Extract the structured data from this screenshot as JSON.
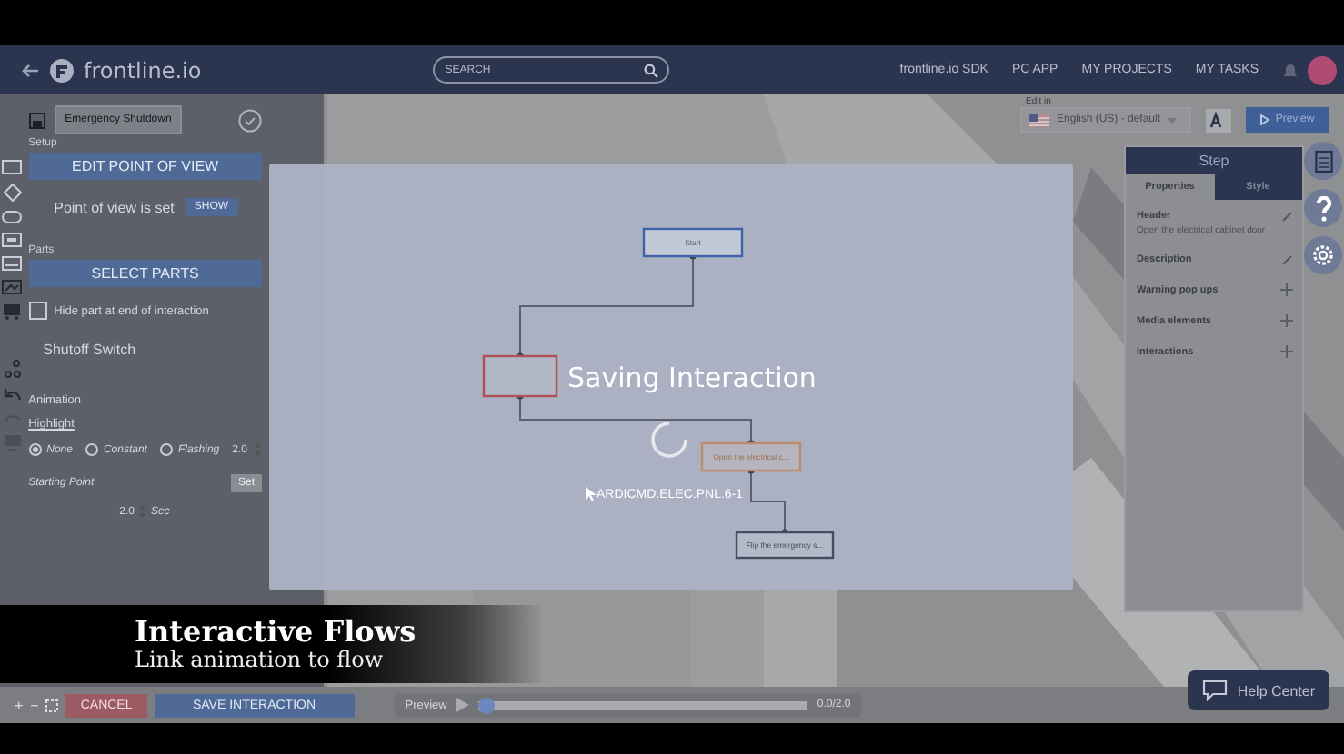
{
  "nav": {
    "logo": "frontline.io",
    "search": {
      "placeholder": "SEARCH"
    },
    "links": [
      "frontline.io SDK",
      "PC APP",
      "MY PROJECTS",
      "MY TASKS"
    ]
  },
  "left_panel": {
    "title": "Emergency Shutdown",
    "ghost_labels": [
      "Setup",
      "Parts"
    ],
    "pov_header": "EDIT POINT OF VIEW",
    "pov_status": "Point of view is set",
    "show_button": "SHOW",
    "parts_header": "SELECT PARTS",
    "hide_part": {
      "label": "Hide part at end of interaction",
      "checked": false
    },
    "part_name": "Shutoff Switch",
    "animation_label": "Animation",
    "highlight_label": "Highlight",
    "highlight_options": [
      {
        "label": "None",
        "selected": true
      },
      {
        "label": "Constant",
        "selected": false
      },
      {
        "label": "Flashing",
        "selected": false
      }
    ],
    "highlight_duration": "2.0",
    "starting_point": "Starting Point",
    "set_button": "Set",
    "start_duration": "2.0",
    "unit": "Sec"
  },
  "editor_toolbar": {
    "edit_in_label": "Edit in",
    "language": "English (US) - default",
    "preview_button": "Preview"
  },
  "step_panel": {
    "title": "Step",
    "tabs": [
      {
        "label": "Properties",
        "selected": true
      },
      {
        "label": "Style",
        "selected": false
      }
    ],
    "fields": [
      {
        "label": "Header",
        "value": "Open the electrical cabinet door",
        "kind": "edit"
      },
      {
        "label": "Description",
        "kind": "edit"
      },
      {
        "label": "Warning pop ups",
        "kind": "add"
      },
      {
        "label": "Media elements",
        "kind": "add"
      },
      {
        "label": "Interactions",
        "kind": "add"
      }
    ]
  },
  "dialog": {
    "message": "Saving Interaction",
    "cursor_label": "ARDICMD.ELEC.PNL.6-1",
    "nodes": [
      {
        "label": "Start",
        "kind": "start"
      },
      {
        "kind": "selected"
      },
      {
        "label": "Open the electrical c...",
        "kind": "pending"
      },
      {
        "label": "Flip the emergency s...",
        "kind": "step"
      }
    ]
  },
  "caption": {
    "title": "Interactive Flows",
    "subtitle": "Link animation to flow"
  },
  "bottom_bar": {
    "cancel_button": "CANCEL",
    "save_button": "SAVE INTERACTION",
    "zoom_in": "+",
    "zoom_out": "−",
    "timeline": {
      "label": "Preview",
      "level": 0.0,
      "reading": "0.0/2.0"
    }
  },
  "help_button": "Help Center"
}
